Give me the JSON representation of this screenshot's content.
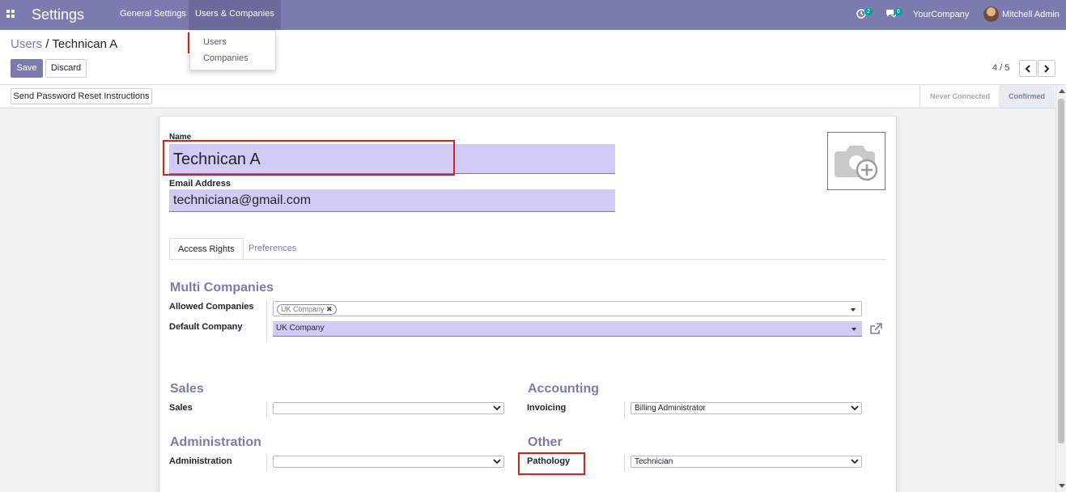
{
  "navbar": {
    "brand": "Settings",
    "menu": [
      {
        "label": "General Settings"
      },
      {
        "label": "Users & Companies"
      }
    ],
    "activity_count": "2",
    "message_count": "6",
    "company": "YourCompany",
    "user": "Mitchell Admin"
  },
  "dropdown": {
    "items": [
      {
        "label": "Users"
      },
      {
        "label": "Companies"
      }
    ]
  },
  "breadcrumb": {
    "parent": "Users",
    "separator": "/",
    "current": "Technican A"
  },
  "buttons": {
    "save": "Save",
    "discard": "Discard",
    "reset_password": "Send Password Reset Instructions"
  },
  "pager": {
    "value": "4 / 5"
  },
  "status": {
    "stages": [
      {
        "label": "Never Connected"
      },
      {
        "label": "Confirmed"
      }
    ]
  },
  "form": {
    "name_label": "Name",
    "name_value": "Technican A",
    "email_label": "Email Address",
    "email_value": "techniciana@gmail.com",
    "tabs": [
      {
        "label": "Access Rights"
      },
      {
        "label": "Preferences"
      }
    ],
    "multi_companies": {
      "title": "Multi Companies",
      "allowed_label": "Allowed Companies",
      "allowed_tag": "UK Company",
      "default_label": "Default Company",
      "default_value": "UK Company"
    },
    "sales": {
      "title": "Sales",
      "field_label": "Sales",
      "value": ""
    },
    "accounting": {
      "title": "Accounting",
      "field_label": "Invoicing",
      "value": "Billing Administrator"
    },
    "administration": {
      "title": "Administration",
      "field_label": "Administration",
      "value": ""
    },
    "other": {
      "title": "Other",
      "field_label": "Pathology",
      "value": "Technician"
    }
  },
  "colors": {
    "brand": "#7c7bad",
    "field_fill": "#d0ccf6",
    "highlight": "#e21b1b"
  }
}
